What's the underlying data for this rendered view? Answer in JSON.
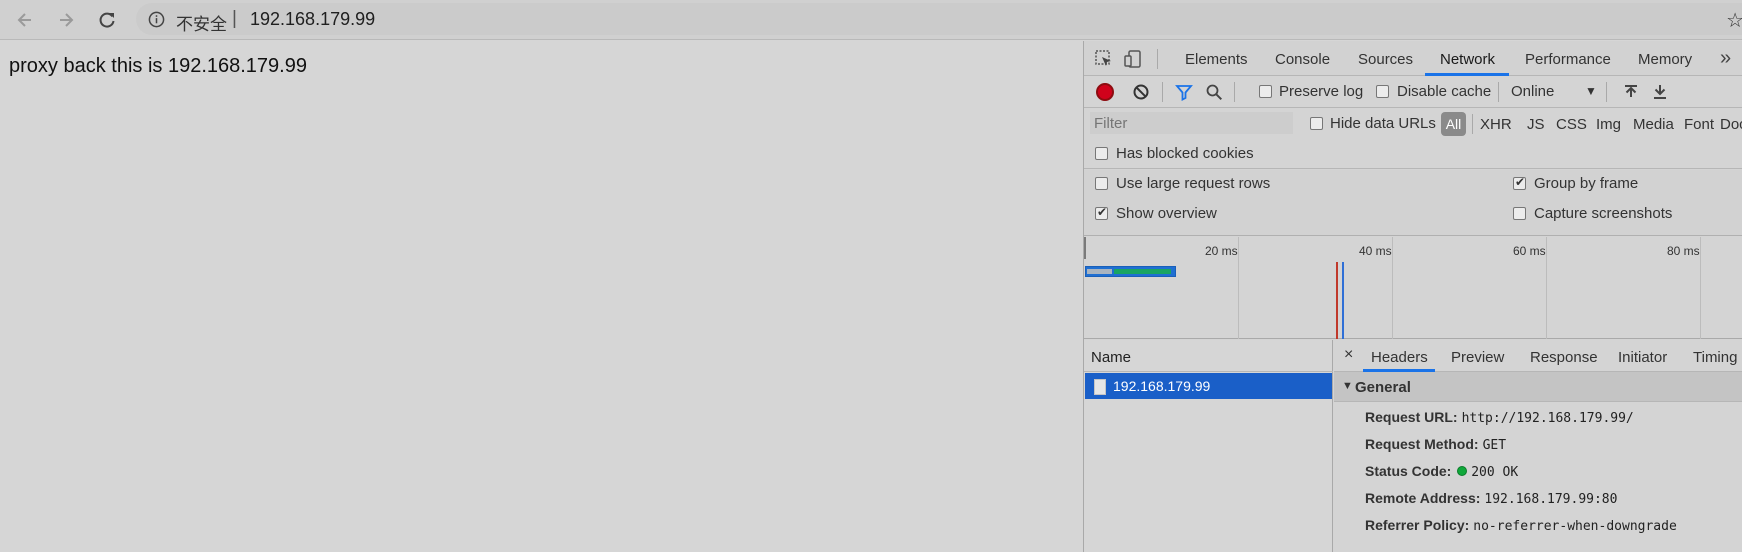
{
  "browser": {
    "security_label": "不安全",
    "separator": "|",
    "url": "192.168.179.99"
  },
  "page": {
    "text": "proxy back this is 192.168.179.99"
  },
  "devtools": {
    "tabs": [
      "Elements",
      "Console",
      "Sources",
      "Network",
      "Performance",
      "Memory"
    ],
    "active_tab": "Network",
    "more": "»",
    "toolbar": {
      "preserve_log": "Preserve log",
      "disable_cache": "Disable cache",
      "throttle": "Online"
    },
    "filter": {
      "placeholder": "Filter",
      "hide_data_urls": "Hide data URLs",
      "all": "All",
      "types": [
        "XHR",
        "JS",
        "CSS",
        "Img",
        "Media",
        "Font",
        "Doc"
      ]
    },
    "has_blocked_cookies": "Has blocked cookies",
    "settings": {
      "use_large_rows": "Use large request rows",
      "show_overview": "Show overview",
      "group_by_frame": "Group by frame",
      "capture_screenshots": "Capture screenshots"
    },
    "overview_ticks": [
      "20 ms",
      "40 ms",
      "60 ms",
      "80 ms"
    ],
    "list": {
      "header": "Name",
      "rows": [
        "192.168.179.99"
      ]
    },
    "details": {
      "close": "×",
      "tabs": [
        "Headers",
        "Preview",
        "Response",
        "Initiator",
        "Timing"
      ],
      "active_tab": "Headers",
      "section": "General",
      "fields": [
        {
          "key": "Request URL:",
          "value": "http://192.168.179.99/"
        },
        {
          "key": "Request Method:",
          "value": "GET"
        },
        {
          "key": "Status Code:",
          "value": "200 OK"
        },
        {
          "key": "Remote Address:",
          "value": "192.168.179.99:80"
        },
        {
          "key": "Referrer Policy:",
          "value": "no-referrer-when-downgrade"
        }
      ]
    }
  },
  "colors": {
    "record": "#d0021b",
    "selected_row": "#1a5fc8",
    "active_tab_underline": "#1a73e8",
    "status_ok": "#0fa83a"
  }
}
